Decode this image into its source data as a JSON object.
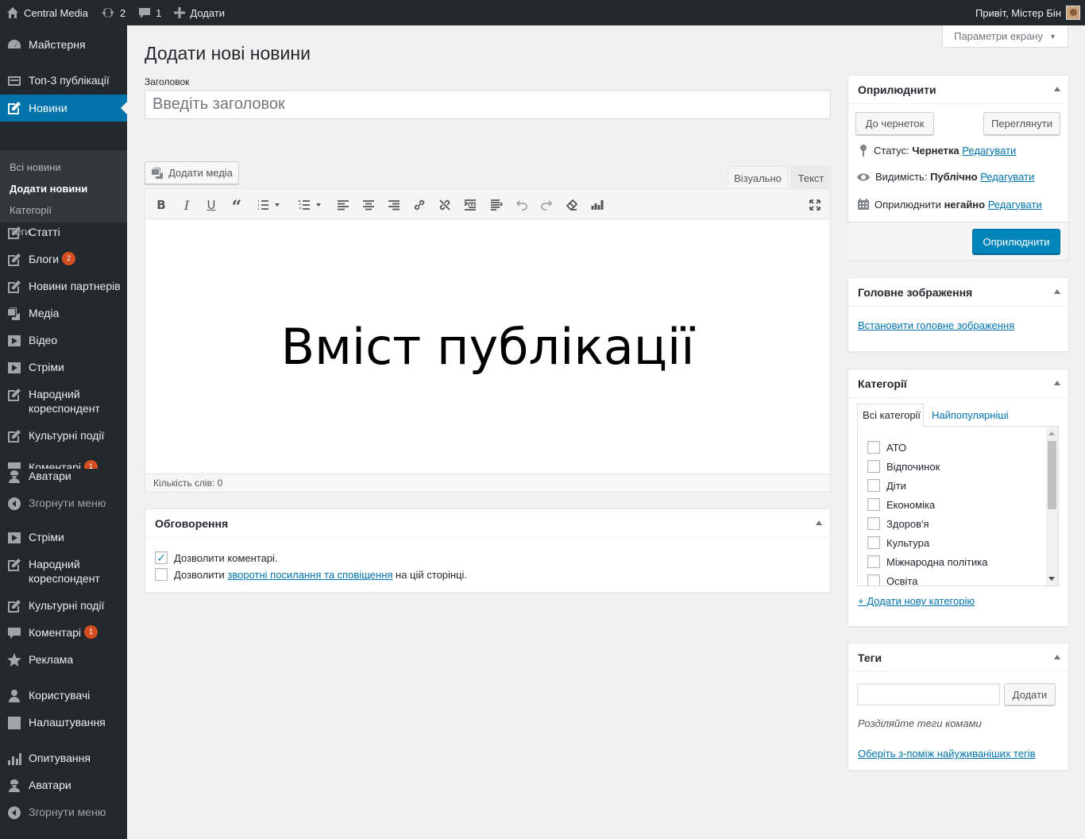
{
  "adminbar": {
    "site_name": "Central Media",
    "updates_count": "2",
    "comments_count": "1",
    "new_label": "Додати",
    "greeting": "Привіт, Містер Бін"
  },
  "sidebar": {
    "items": [
      {
        "label": "Майстерня",
        "icon": "dashboard-icon"
      },
      {
        "label": "Топ-3 публікації",
        "icon": "top-posts-icon"
      },
      {
        "label": "Новини",
        "icon": "edit-icon"
      },
      {
        "label": "Статті",
        "icon": "edit-icon"
      },
      {
        "label": "Блоги",
        "icon": "edit-icon",
        "badge": "2"
      },
      {
        "label": "Новини партнерів",
        "icon": "edit-icon"
      },
      {
        "label": "Медіа",
        "icon": "media-icon"
      },
      {
        "label": "Відео",
        "icon": "video-icon"
      },
      {
        "label": "Стріми",
        "icon": "video-icon"
      },
      {
        "label": "Народний кореспондент",
        "icon": "edit-icon"
      },
      {
        "label": "Культурні події",
        "icon": "edit-icon"
      },
      {
        "label": "Коментарі",
        "icon": "comments-icon",
        "badge": "1"
      },
      {
        "label": "Аватари",
        "icon": "avatar-icon"
      },
      {
        "label": "Згорнути меню",
        "icon": "collapse-icon"
      },
      {
        "label": "Стріми",
        "icon": "video-icon"
      },
      {
        "label": "Народний кореспондент",
        "icon": "edit-icon"
      },
      {
        "label": "Культурні події",
        "icon": "edit-icon"
      },
      {
        "label": "Коментарі",
        "icon": "comments-icon",
        "badge": "1"
      },
      {
        "label": "Реклама",
        "icon": "star-icon"
      },
      {
        "label": "Користувачі",
        "icon": "users-icon"
      },
      {
        "label": "Налаштування",
        "icon": "settings-icon"
      },
      {
        "label": "Опитування",
        "icon": "chart-icon"
      },
      {
        "label": "Аватари",
        "icon": "avatar-icon"
      },
      {
        "label": "Згорнути меню",
        "icon": "collapse-icon"
      }
    ],
    "submenu": [
      "Всі новини",
      "Додати новини",
      "Категорії",
      "Теги"
    ]
  },
  "screen_options": "Параметри екрану",
  "page_title": "Додати нові новини",
  "title_field": {
    "label": "Заголовок",
    "placeholder": "Введіть заголовок",
    "value": ""
  },
  "editor": {
    "add_media": "Додати медіа",
    "tab_visual": "Візуально",
    "tab_text": "Текст",
    "content": "Вміст публікації",
    "word_count": "Кількість слів: 0"
  },
  "discussion": {
    "title": "Обговорення",
    "allow_comments": "Дозволити коментарі.",
    "allow_comments_checked": true,
    "trackbacks_prefix": "Дозволити",
    "trackbacks_link": "зворотні посилання та сповіщення",
    "trackbacks_suffix": "на цій сторінці.",
    "trackbacks_checked": false
  },
  "publish": {
    "title": "Оприлюднити",
    "save_draft": "До чернеток",
    "preview": "Переглянути",
    "status_label": "Статус:",
    "status_value": "Чернетка",
    "visibility_label": "Видимість:",
    "visibility_value": "Публічно",
    "schedule_label": "Оприлюднити",
    "schedule_value": "негайно",
    "edit_link": "Редагувати",
    "publish_button": "Оприлюднити"
  },
  "featured_image": {
    "title": "Головне зображення",
    "set_link": "Встановити головне зображення"
  },
  "categories": {
    "title": "Категорії",
    "tab_all": "Всі категорії",
    "tab_popular": "Найпопулярніші",
    "items": [
      "АТО",
      "Відпочинок",
      "Діти",
      "Економіка",
      "Здоров'я",
      "Культура",
      "Міжнародна політика",
      "Освіта"
    ],
    "add_new": "+ Додати нову категорію"
  },
  "tags": {
    "title": "Теги",
    "add_button": "Додати",
    "input_value": "",
    "hint": "Розділяйте теги комами",
    "choose_link": "Оберіть з-поміж найуживаніших тегів"
  },
  "colors": {
    "accent": "#0073aa",
    "primary_button": "#0085ba",
    "sidebar": "#23282d",
    "badge": "#d54e21"
  }
}
